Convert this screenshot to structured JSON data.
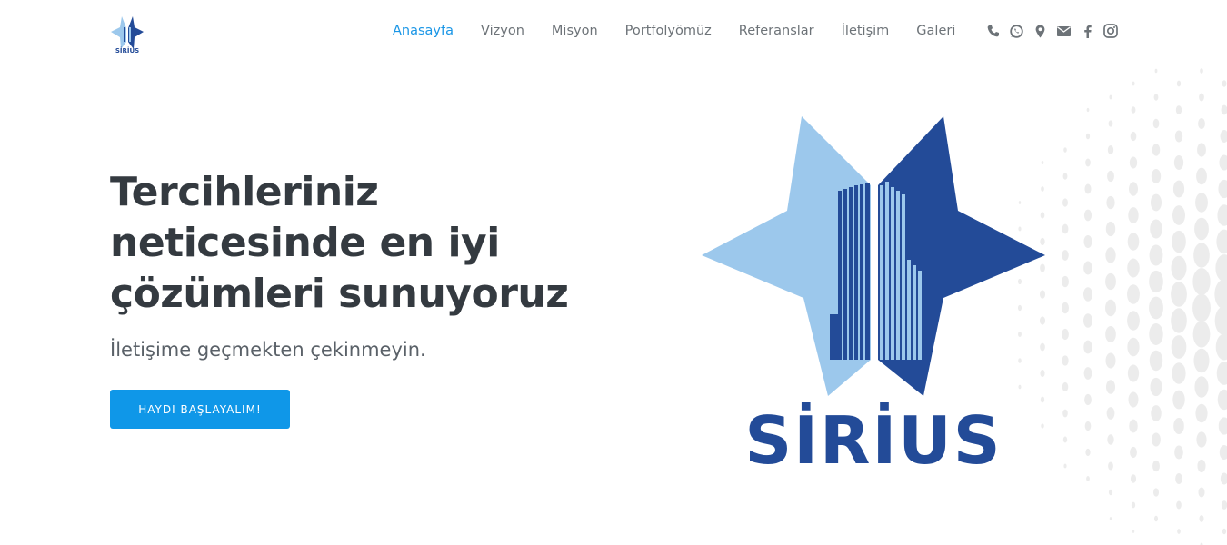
{
  "nav": {
    "items": [
      {
        "label": "Anasayfa",
        "active": true
      },
      {
        "label": "Vizyon",
        "active": false
      },
      {
        "label": "Misyon",
        "active": false
      },
      {
        "label": "Portfolyömüz",
        "active": false
      },
      {
        "label": "Referanslar",
        "active": false
      },
      {
        "label": "İletişim",
        "active": false
      },
      {
        "label": "Galeri",
        "active": false
      }
    ],
    "social_icons": [
      "phone-icon",
      "whatsapp-icon",
      "map-pin-icon",
      "mail-icon",
      "facebook-icon",
      "instagram-icon"
    ]
  },
  "brand": {
    "logo_text": "SİRİUS"
  },
  "hero": {
    "title": "Tercihleriniz neticesinde en iyi çözümleri sunuyoruz",
    "subtitle": "İletişime geçmekten çekinmeyin.",
    "cta_label": "HAYDI BAŞLAYALIM!"
  },
  "colors": {
    "accent": "#1a96e6",
    "button": "#0f97e8",
    "heading": "#343a40",
    "nav_text": "#6d7378",
    "logo_dark": "#234b98",
    "logo_light": "#9cc8ec"
  }
}
